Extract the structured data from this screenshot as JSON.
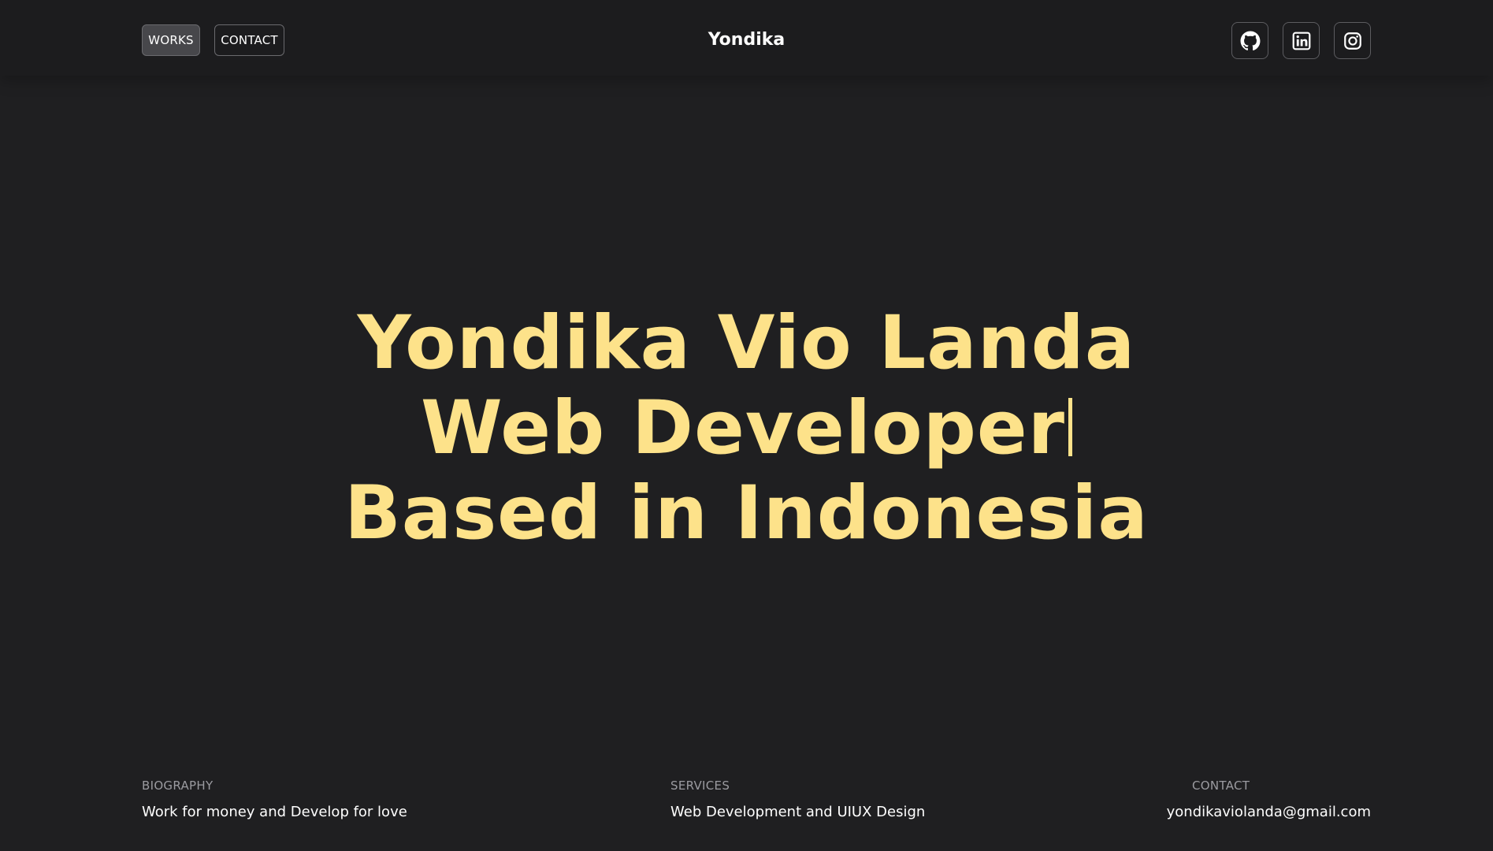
{
  "header": {
    "nav": [
      {
        "label": "WORKS"
      },
      {
        "label": "CONTACT"
      }
    ],
    "brand": "Yondika",
    "social": [
      {
        "icon": "github-icon"
      },
      {
        "icon": "linkedin-icon"
      },
      {
        "icon": "instagram-icon"
      }
    ]
  },
  "hero": {
    "line1": "Yondika Vio Landa",
    "line2": "Web Developer",
    "line3": "Based in Indonesia"
  },
  "info": {
    "biography": {
      "label": "BIOGRAPHY",
      "value": "Work for money and Develop for love"
    },
    "services": {
      "label": "SERVICES",
      "value": "Web Development and UIUX Design"
    },
    "contact": {
      "label": "CONTACT",
      "value": "yondikaviolanda@gmail.com"
    }
  },
  "colors": {
    "background": "#1f1f21",
    "accent": "#fde28a",
    "text": "#ffffff",
    "muted": "#9b9ba0"
  }
}
